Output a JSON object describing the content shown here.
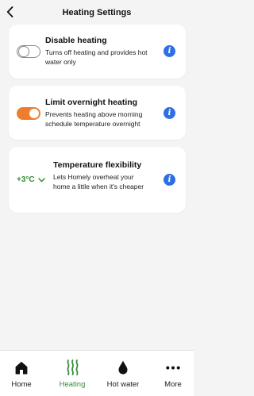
{
  "header": {
    "title": "Heating Settings"
  },
  "settings": [
    {
      "title": "Disable heating",
      "description": "Turns off heating and provides hot water only",
      "state": "off"
    },
    {
      "title": "Limit overnight heating",
      "description": "Prevents heating above morning schedule temperature overnight",
      "state": "on"
    },
    {
      "title": "Temperature flexibility",
      "description": "Lets Homely overheat your home a little when it's cheaper",
      "value": "+3°C"
    }
  ],
  "colors": {
    "accent_orange": "#ee7d2d",
    "accent_green": "#3a8a3a",
    "info_blue": "#2f6fe4"
  },
  "tabs": [
    {
      "label": "Home",
      "icon": "home-icon",
      "active": false
    },
    {
      "label": "Heating",
      "icon": "heating-icon",
      "active": true
    },
    {
      "label": "Hot water",
      "icon": "water-drop-icon",
      "active": false
    },
    {
      "label": "More",
      "icon": "more-dots-icon",
      "active": false
    }
  ]
}
